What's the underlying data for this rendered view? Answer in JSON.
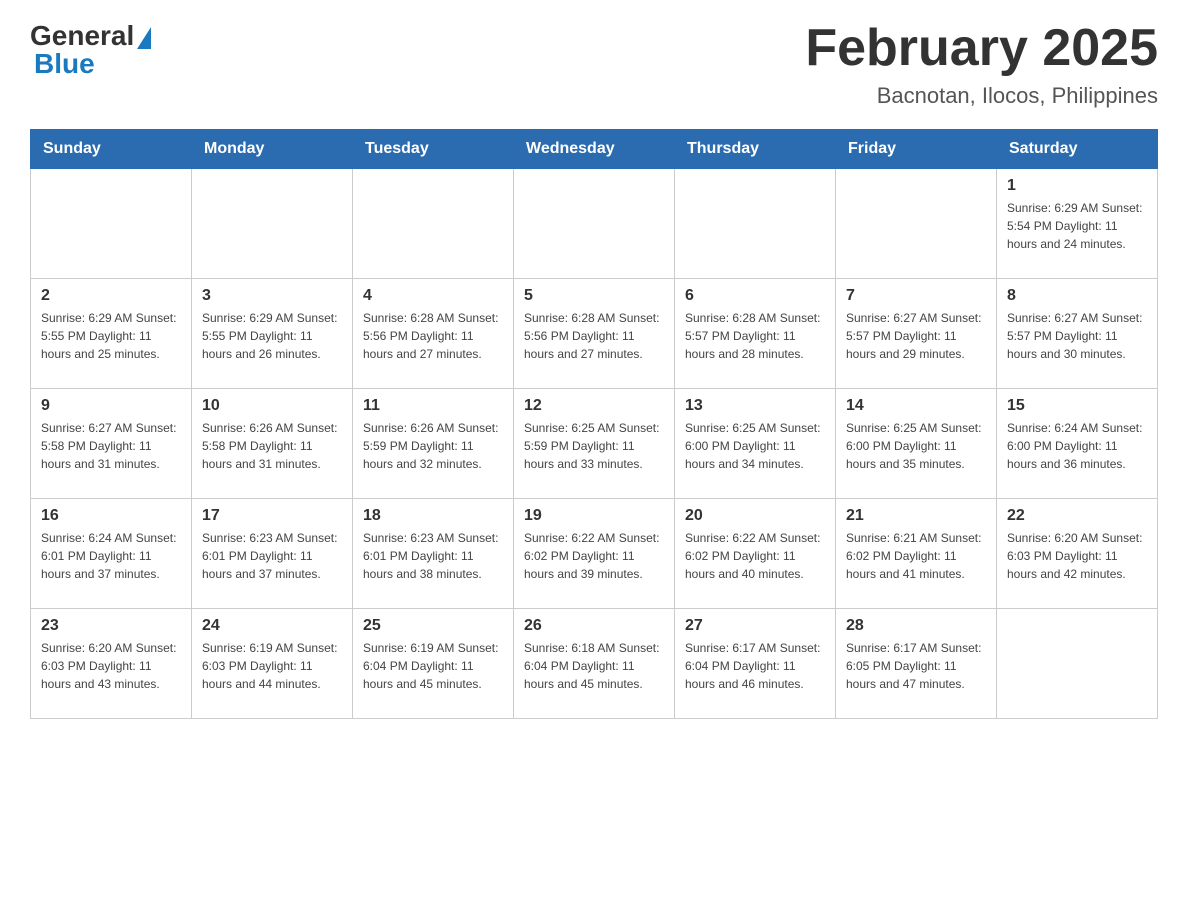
{
  "header": {
    "logo_general": "General",
    "logo_blue": "Blue",
    "title": "February 2025",
    "subtitle": "Bacnotan, Ilocos, Philippines"
  },
  "weekdays": [
    "Sunday",
    "Monday",
    "Tuesday",
    "Wednesday",
    "Thursday",
    "Friday",
    "Saturday"
  ],
  "weeks": [
    [
      {
        "day": "",
        "info": ""
      },
      {
        "day": "",
        "info": ""
      },
      {
        "day": "",
        "info": ""
      },
      {
        "day": "",
        "info": ""
      },
      {
        "day": "",
        "info": ""
      },
      {
        "day": "",
        "info": ""
      },
      {
        "day": "1",
        "info": "Sunrise: 6:29 AM\nSunset: 5:54 PM\nDaylight: 11 hours\nand 24 minutes."
      }
    ],
    [
      {
        "day": "2",
        "info": "Sunrise: 6:29 AM\nSunset: 5:55 PM\nDaylight: 11 hours\nand 25 minutes."
      },
      {
        "day": "3",
        "info": "Sunrise: 6:29 AM\nSunset: 5:55 PM\nDaylight: 11 hours\nand 26 minutes."
      },
      {
        "day": "4",
        "info": "Sunrise: 6:28 AM\nSunset: 5:56 PM\nDaylight: 11 hours\nand 27 minutes."
      },
      {
        "day": "5",
        "info": "Sunrise: 6:28 AM\nSunset: 5:56 PM\nDaylight: 11 hours\nand 27 minutes."
      },
      {
        "day": "6",
        "info": "Sunrise: 6:28 AM\nSunset: 5:57 PM\nDaylight: 11 hours\nand 28 minutes."
      },
      {
        "day": "7",
        "info": "Sunrise: 6:27 AM\nSunset: 5:57 PM\nDaylight: 11 hours\nand 29 minutes."
      },
      {
        "day": "8",
        "info": "Sunrise: 6:27 AM\nSunset: 5:57 PM\nDaylight: 11 hours\nand 30 minutes."
      }
    ],
    [
      {
        "day": "9",
        "info": "Sunrise: 6:27 AM\nSunset: 5:58 PM\nDaylight: 11 hours\nand 31 minutes."
      },
      {
        "day": "10",
        "info": "Sunrise: 6:26 AM\nSunset: 5:58 PM\nDaylight: 11 hours\nand 31 minutes."
      },
      {
        "day": "11",
        "info": "Sunrise: 6:26 AM\nSunset: 5:59 PM\nDaylight: 11 hours\nand 32 minutes."
      },
      {
        "day": "12",
        "info": "Sunrise: 6:25 AM\nSunset: 5:59 PM\nDaylight: 11 hours\nand 33 minutes."
      },
      {
        "day": "13",
        "info": "Sunrise: 6:25 AM\nSunset: 6:00 PM\nDaylight: 11 hours\nand 34 minutes."
      },
      {
        "day": "14",
        "info": "Sunrise: 6:25 AM\nSunset: 6:00 PM\nDaylight: 11 hours\nand 35 minutes."
      },
      {
        "day": "15",
        "info": "Sunrise: 6:24 AM\nSunset: 6:00 PM\nDaylight: 11 hours\nand 36 minutes."
      }
    ],
    [
      {
        "day": "16",
        "info": "Sunrise: 6:24 AM\nSunset: 6:01 PM\nDaylight: 11 hours\nand 37 minutes."
      },
      {
        "day": "17",
        "info": "Sunrise: 6:23 AM\nSunset: 6:01 PM\nDaylight: 11 hours\nand 37 minutes."
      },
      {
        "day": "18",
        "info": "Sunrise: 6:23 AM\nSunset: 6:01 PM\nDaylight: 11 hours\nand 38 minutes."
      },
      {
        "day": "19",
        "info": "Sunrise: 6:22 AM\nSunset: 6:02 PM\nDaylight: 11 hours\nand 39 minutes."
      },
      {
        "day": "20",
        "info": "Sunrise: 6:22 AM\nSunset: 6:02 PM\nDaylight: 11 hours\nand 40 minutes."
      },
      {
        "day": "21",
        "info": "Sunrise: 6:21 AM\nSunset: 6:02 PM\nDaylight: 11 hours\nand 41 minutes."
      },
      {
        "day": "22",
        "info": "Sunrise: 6:20 AM\nSunset: 6:03 PM\nDaylight: 11 hours\nand 42 minutes."
      }
    ],
    [
      {
        "day": "23",
        "info": "Sunrise: 6:20 AM\nSunset: 6:03 PM\nDaylight: 11 hours\nand 43 minutes."
      },
      {
        "day": "24",
        "info": "Sunrise: 6:19 AM\nSunset: 6:03 PM\nDaylight: 11 hours\nand 44 minutes."
      },
      {
        "day": "25",
        "info": "Sunrise: 6:19 AM\nSunset: 6:04 PM\nDaylight: 11 hours\nand 45 minutes."
      },
      {
        "day": "26",
        "info": "Sunrise: 6:18 AM\nSunset: 6:04 PM\nDaylight: 11 hours\nand 45 minutes."
      },
      {
        "day": "27",
        "info": "Sunrise: 6:17 AM\nSunset: 6:04 PM\nDaylight: 11 hours\nand 46 minutes."
      },
      {
        "day": "28",
        "info": "Sunrise: 6:17 AM\nSunset: 6:05 PM\nDaylight: 11 hours\nand 47 minutes."
      },
      {
        "day": "",
        "info": ""
      }
    ]
  ]
}
